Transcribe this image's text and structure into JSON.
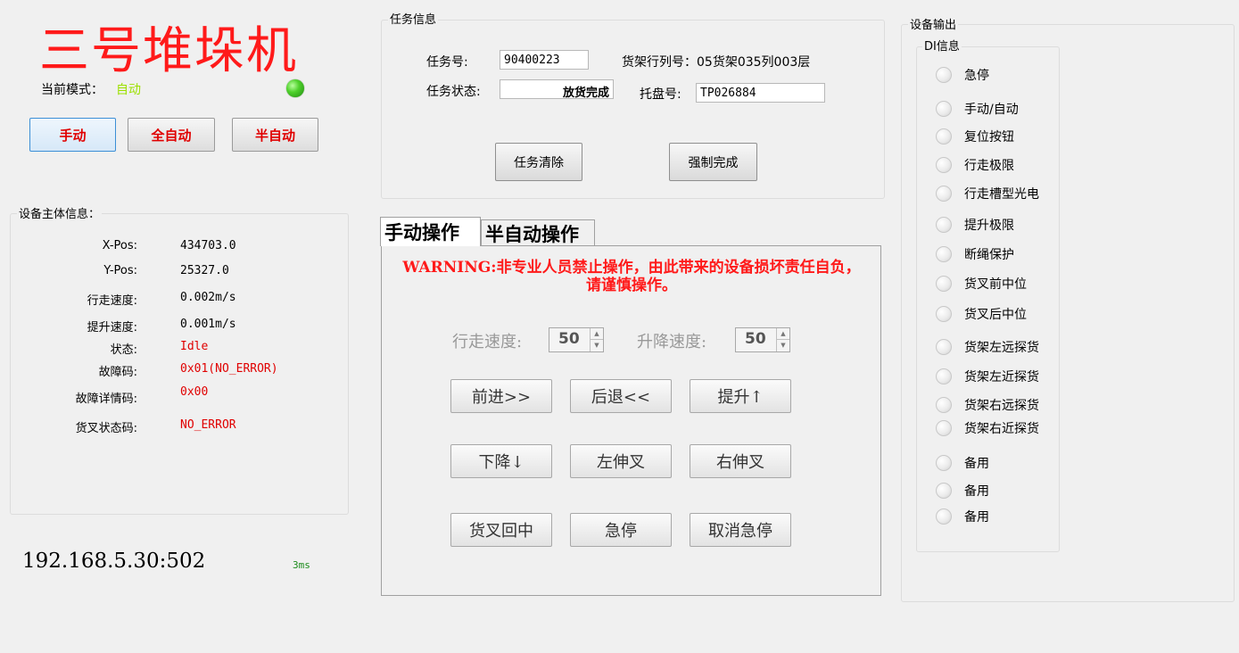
{
  "header": {
    "title": "三号堆垛机",
    "mode_label": "当前模式：",
    "mode_value": "自动",
    "mode_color": "#9be000",
    "buttons": {
      "manual": "手动",
      "full_auto": "全自动",
      "semi_auto": "半自动"
    }
  },
  "device_info": {
    "title": "设备主体信息：",
    "rows": [
      {
        "label": "X-Pos:",
        "value": "434703.0"
      },
      {
        "label": "Y-Pos:",
        "value": "25327.0"
      },
      {
        "label": "行走速度:",
        "value": "0.002m/s"
      },
      {
        "label": "提升速度:",
        "value": "0.001m/s"
      },
      {
        "label": "状态:",
        "value": "Idle"
      },
      {
        "label": "故障码:",
        "value": "0x01(NO_ERROR)"
      },
      {
        "label": "故障详情码:",
        "value": "0x00"
      },
      {
        "label": "货叉状态码:",
        "value": "NO_ERROR"
      }
    ]
  },
  "connection": {
    "address": "192.168.5.30:502",
    "latency": "3ms"
  },
  "task_info": {
    "title": "任务信息",
    "task_no_label": "任务号:",
    "task_no": "90400223",
    "location_label": "货架行列号：",
    "location": "05货架035列003层",
    "status_label": "任务状态:",
    "status": "放货完成",
    "pallet_label": "托盘号:",
    "pallet": "TP026884",
    "clear_button": "任务清除",
    "force_button": "强制完成"
  },
  "operation": {
    "tabs": [
      "手动操作",
      "半自动操作"
    ],
    "warning": "WARNING:非专业人员禁止操作，由此带来的设备损坏责任自负，请谨慎操作。",
    "travel_speed_label": "行走速度:",
    "travel_speed": "50",
    "lift_speed_label": "升降速度:",
    "lift_speed": "50",
    "buttons": [
      "前进>>",
      "后退<<",
      "提升↑",
      "下降↓",
      "左伸叉",
      "右伸叉",
      "货叉回中",
      "急停",
      "取消急停"
    ]
  },
  "device_output": {
    "title": "设备输出",
    "di_title": "DI信息",
    "items": [
      "急停",
      "手动/自动",
      "复位按钮",
      "行走极限",
      "行走槽型光电",
      "提升极限",
      "断绳保护",
      "货叉前中位",
      "货叉后中位",
      "货架左远探货",
      "货架左近探货",
      "货架右远探货",
      "货架右近探货",
      "备用",
      "备用",
      "备用"
    ]
  }
}
